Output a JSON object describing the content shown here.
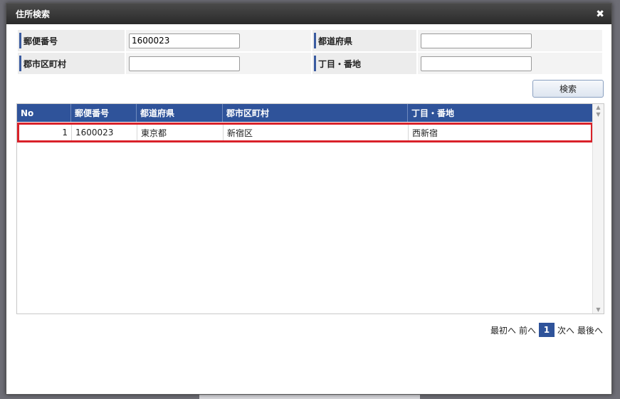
{
  "dialog": {
    "title": "住所検索"
  },
  "form": {
    "zip_label": "郵便番号",
    "zip_value": "1600023",
    "pref_label": "都道府県",
    "pref_value": "",
    "city_label": "郡市区町村",
    "city_value": "",
    "addr_label": "丁目・番地",
    "addr_value": ""
  },
  "search_button": "検索",
  "grid": {
    "columns": [
      "No",
      "郵便番号",
      "都道府県",
      "郡市区町村",
      "丁目・番地"
    ],
    "rows": [
      {
        "no": "1",
        "zip": "1600023",
        "pref": "東京都",
        "city": "新宿区",
        "addr": "西新宿"
      }
    ]
  },
  "pager": {
    "first": "最初へ",
    "prev": "前へ",
    "current": "1",
    "next": "次へ",
    "last": "最後へ"
  },
  "colors": {
    "header": "#2f539a",
    "highlight": "#d9222a"
  }
}
